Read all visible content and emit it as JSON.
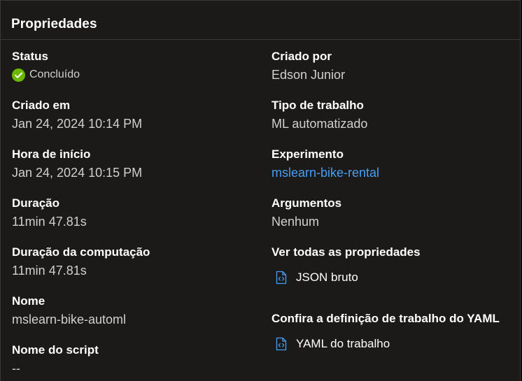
{
  "panel": {
    "title": "Propriedades"
  },
  "left": {
    "status": {
      "label": "Status",
      "value": "Concluído"
    },
    "created_on": {
      "label": "Criado em",
      "value": "Jan 24, 2024 10:14 PM"
    },
    "start_time": {
      "label": "Hora de início",
      "value": "Jan 24, 2024 10:15 PM"
    },
    "duration": {
      "label": "Duração",
      "value": "11min 47.81s"
    },
    "compute_duration": {
      "label": "Duração da computação",
      "value": "11min 47.81s"
    },
    "name": {
      "label": "Nome",
      "value": "mslearn-bike-automl"
    },
    "script_name": {
      "label": "Nome do script",
      "value": "--"
    }
  },
  "right": {
    "created_by": {
      "label": "Criado por",
      "value": "Edson Junior"
    },
    "job_type": {
      "label": "Tipo de trabalho",
      "value": "ML automatizado"
    },
    "experiment": {
      "label": "Experimento",
      "value": "mslearn-bike-rental"
    },
    "arguments": {
      "label": "Argumentos",
      "value": "Nenhum"
    },
    "all_properties": {
      "label": "Ver todas as propriedades",
      "link_text": "JSON bruto"
    },
    "yaml_definition": {
      "label": "Confira a definição de trabalho do YAML",
      "link_text": "YAML do trabalho"
    }
  },
  "colors": {
    "background": "#1b1a19",
    "border": "#3b3a39",
    "link": "#479ef5",
    "success": "#6bb700",
    "value_text": "#d2d0ce"
  },
  "icons": {
    "status": "success-check-icon",
    "file": "code-file-icon"
  }
}
